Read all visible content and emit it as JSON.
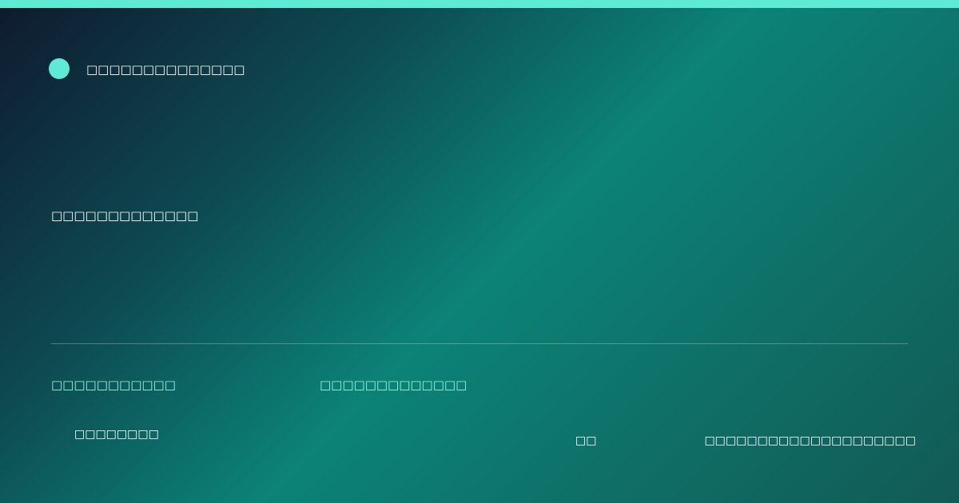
{
  "colors": {
    "accent": "#5eead4",
    "meta_text": "#99f6e4",
    "bg_dark": "#0f1a2e",
    "bg_teal": "#0c8377"
  },
  "brand": {
    "name": "□□□□□□□□□□□□□□"
  },
  "headline": "□□□□□□□□□□□□□",
  "meta": {
    "left": "□□□□□□□□□□□",
    "right": "□□□□□□□□□□□□□"
  },
  "tag": "□□□□□□□□",
  "footer": {
    "middle": "□□",
    "right": "□□□□□□□□□□□□□□□□□□□□"
  }
}
